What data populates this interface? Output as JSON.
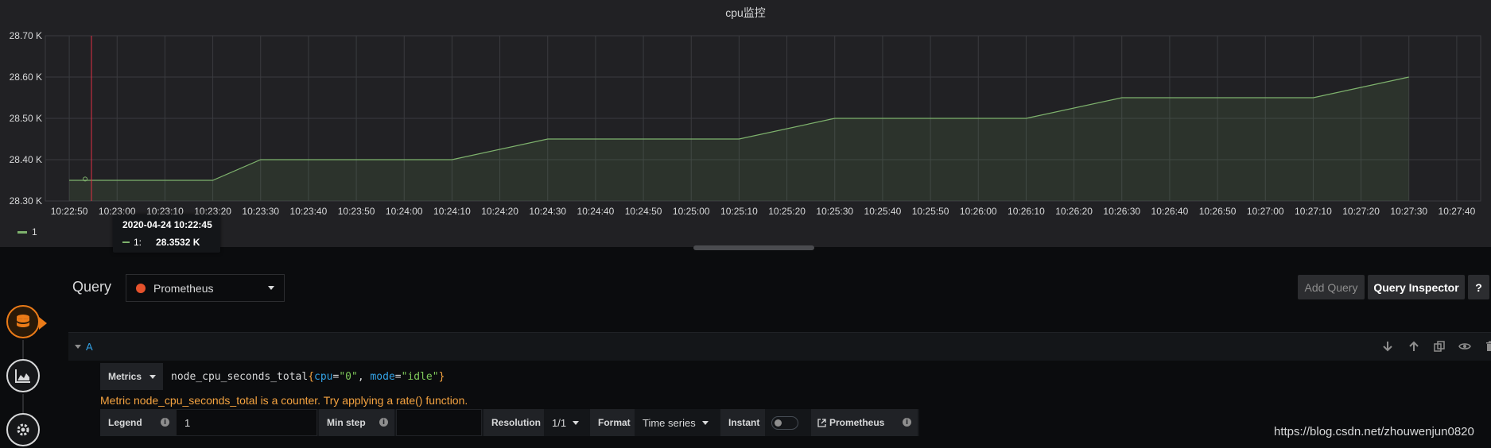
{
  "panel": {
    "title": "cpu监控",
    "legend_label": "1",
    "tooltip": {
      "time": "2020-04-24 10:22:45",
      "series": "1:",
      "value": "28.3532 K"
    }
  },
  "colors": {
    "series": "#7eb26d",
    "accent": "#eb7b18",
    "link": "#33a2e5",
    "warning": "#f5a340",
    "cursor": "#e02f44"
  },
  "chart_data": {
    "type": "line",
    "series": [
      {
        "name": "1",
        "points": [
          [
            "10:22:50",
            28.35
          ],
          [
            "10:23:20",
            28.35
          ],
          [
            "10:23:30",
            28.4
          ],
          [
            "10:24:10",
            28.4
          ],
          [
            "10:24:30",
            28.45
          ],
          [
            "10:25:10",
            28.45
          ],
          [
            "10:25:30",
            28.5
          ],
          [
            "10:26:10",
            28.5
          ],
          [
            "10:26:30",
            28.55
          ],
          [
            "10:27:10",
            28.55
          ],
          [
            "10:27:30",
            28.6
          ]
        ]
      }
    ],
    "x_ticks": [
      "10:22:50",
      "10:23:00",
      "10:23:10",
      "10:23:20",
      "10:23:30",
      "10:23:40",
      "10:23:50",
      "10:24:00",
      "10:24:10",
      "10:24:20",
      "10:24:30",
      "10:24:40",
      "10:24:50",
      "10:25:00",
      "10:25:10",
      "10:25:20",
      "10:25:30",
      "10:25:40",
      "10:25:50",
      "10:26:00",
      "10:26:10",
      "10:26:20",
      "10:26:30",
      "10:26:40",
      "10:26:50",
      "10:27:00",
      "10:27:10",
      "10:27:20",
      "10:27:30",
      "10:27:40"
    ],
    "y_ticks": [
      "28.70 K",
      "28.60 K",
      "28.50 K",
      "28.40 K",
      "28.30 K"
    ],
    "y_tick_values": [
      28.7,
      28.6,
      28.5,
      28.4,
      28.3
    ],
    "ylim": [
      28.3,
      28.7
    ],
    "xlim": [
      "10:22:45",
      "10:27:45"
    ],
    "cursor_time": "10:22:45",
    "hover_value": 28.3532,
    "grid": true,
    "legend": "bottom-left"
  },
  "query_editor": {
    "title": "Query",
    "datasource": "Prometheus",
    "add_query": "Add Query",
    "query_inspector": "Query Inspector",
    "help": "?",
    "query": {
      "ref_id": "A",
      "metrics_label": "Metrics",
      "expr_parts": {
        "name": "node_cpu_seconds_total",
        "open": "{",
        "k1": "cpu",
        "eq1": "=",
        "v1": "\"0\"",
        "sep": ", ",
        "k2": "mode",
        "eq2": "=",
        "v2": "\"idle\"",
        "close": "}"
      },
      "warning": "Metric node_cpu_seconds_total is a counter. Try applying a rate() function.",
      "legend_label": "Legend",
      "legend_value": "1",
      "min_step_label": "Min step",
      "min_step_value": "",
      "resolution_label": "Resolution",
      "resolution_value": "1/1",
      "format_label": "Format",
      "format_value": "Time series",
      "instant_label": "Instant",
      "instant_on": false,
      "datasource_link": "Prometheus"
    }
  },
  "watermark": "https://blog.csdn.net/zhouwenjun0820"
}
